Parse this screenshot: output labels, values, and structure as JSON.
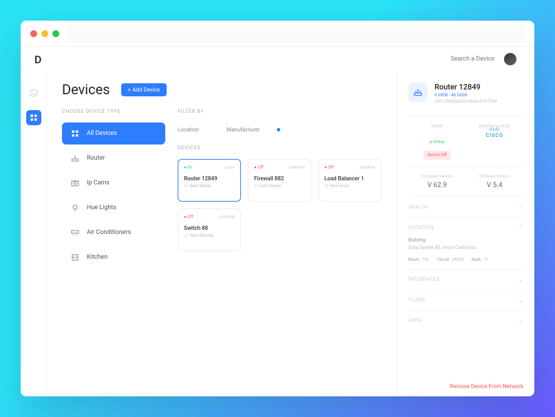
{
  "search": {
    "placeholder": "Search a Device"
  },
  "page": {
    "title": "Devices",
    "add_label": "+ Add Device"
  },
  "labels": {
    "choose": "CHOOSE DEVICE TYPE",
    "filter": "FILTER  BY",
    "devices": "DEVICES"
  },
  "types": [
    {
      "label": "All Devices",
      "active": true,
      "icon": "grid"
    },
    {
      "label": "Router",
      "active": false,
      "icon": "router"
    },
    {
      "label": "Ip Cams",
      "active": false,
      "icon": "cam"
    },
    {
      "label": "Hue Lights",
      "active": false,
      "icon": "bulb"
    },
    {
      "label": "Air Conditioners",
      "active": false,
      "icon": "ac"
    },
    {
      "label": "Kitchen",
      "active": false,
      "icon": "kitchen"
    }
  ],
  "filters": [
    {
      "label": "Location"
    },
    {
      "label": "Manufacturer"
    }
  ],
  "devices": [
    {
      "name": "Router 12849",
      "status": "On",
      "manu": "cisco",
      "loc": "West Witurk",
      "selected": true
    },
    {
      "name": "Firewall 882",
      "status": "Off",
      "manu": "JUNIPER",
      "loc": "East Devies",
      "selected": false
    },
    {
      "name": "Load Balancer 1",
      "status": "Off",
      "manu": "JUNIPER",
      "loc": "New Evron",
      "selected": false
    },
    {
      "name": "Switch 88",
      "status": "Off",
      "manu": "JUNIPER",
      "loc": "West Ricrado",
      "selected": false
    }
  ],
  "detail": {
    "name": "Router 12849",
    "sub": "9.28GB - 40.53GB",
    "ip": "2001:db8:85a3:0:0:8a2e:370:7334",
    "status_label": "Status",
    "status": "Online",
    "switch": "Switch Off",
    "manu_label": "Manufactured By",
    "manu": "CISCO",
    "hw_label": "Firmware Version",
    "hw": "V 62.9",
    "sw_label": "Software Version",
    "sw": "V 5.4",
    "sections": {
      "health": "HEALTH",
      "location": "LOCATION",
      "interfaces": "INTERFACES",
      "vlans": "VLANS",
      "apps": "APPS"
    },
    "loc": {
      "building_l": "Building",
      "building_v": "Data Centre 45, Irvine California",
      "room_l": "Room",
      "room_v": "745",
      "circuit_l": "Circuit",
      "circuit_v": "34528",
      "rack_l": "Rack",
      "rack_v": "11"
    },
    "remove": "Remove Device From Network"
  }
}
